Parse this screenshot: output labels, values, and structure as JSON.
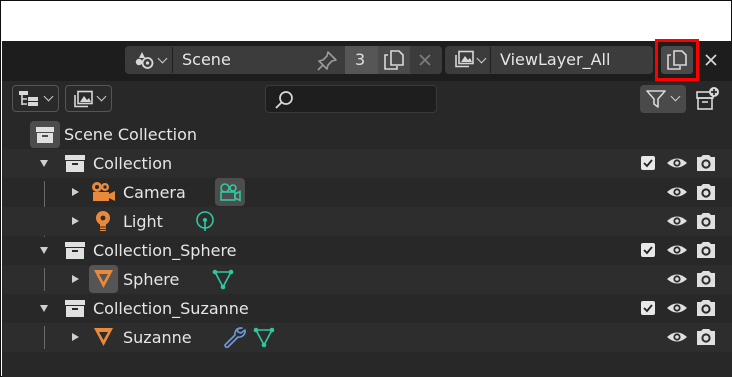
{
  "header": {
    "scene": {
      "icon": "scene-selector-icon",
      "name": "Scene",
      "users_count": "3"
    },
    "view_layer": {
      "icon": "view-layer-icon",
      "name": "ViewLayer_All"
    }
  },
  "toolbar": {
    "display_mode_icon": "outliner-display-mode-icon",
    "filter_icon": "funnel-icon",
    "search": {
      "placeholder": "",
      "value": ""
    },
    "new_collection_icon": "new-collection-icon"
  },
  "outliner": {
    "root_label": "Scene Collection",
    "rows": [
      {
        "label": "Collection",
        "type": "collection",
        "expanded": true
      },
      {
        "label": "Camera",
        "type": "object",
        "data_icon": "camera-data-icon"
      },
      {
        "label": "Light",
        "type": "object",
        "data_icon": "light-data-icon"
      },
      {
        "label": "Collection_Sphere",
        "type": "collection",
        "expanded": true
      },
      {
        "label": "Sphere",
        "type": "object",
        "data_icon": "mesh-data-icon"
      },
      {
        "label": "Collection_Suzanne",
        "type": "collection",
        "expanded": true
      },
      {
        "label": "Suzanne",
        "type": "object",
        "data_icon": "mesh-data-icon",
        "modifier_icon": "wrench-icon"
      }
    ]
  },
  "colors": {
    "highlight": "#ff0000",
    "object_orange": "#e8893c",
    "data_teal": "#2fc8a0",
    "modifier_blue": "#6f9ad8"
  }
}
